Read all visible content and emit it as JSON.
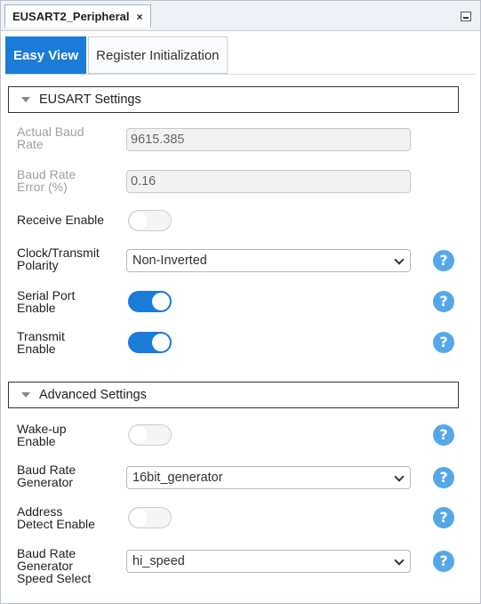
{
  "document_tab": {
    "title": "EUSART2_Peripheral",
    "close_glyph": "×"
  },
  "view_tabs": [
    {
      "label": "Easy View",
      "active": true
    },
    {
      "label": "Register Initialization",
      "active": false
    }
  ],
  "eusart_settings": {
    "header": "EUSART Settings",
    "actual_baud_rate": {
      "label_line1": "Actual Baud",
      "label_line2": "Rate",
      "value": "9615.385"
    },
    "baud_rate_error": {
      "label_line1": "Baud Rate",
      "label_line2": "Error (%)",
      "value": "0.16"
    },
    "receive_enable": {
      "label": "Receive Enable",
      "on": false
    },
    "clock_transmit_polarity": {
      "label_line1": "Clock/Transmit",
      "label_line2": "Polarity",
      "value": "Non-Inverted"
    },
    "serial_port_enable": {
      "label_line1": "Serial Port",
      "label_line2": "Enable",
      "on": true
    },
    "transmit_enable": {
      "label_line1": "Transmit",
      "label_line2": "Enable",
      "on": true
    }
  },
  "advanced_settings": {
    "header": "Advanced Settings",
    "wake_up_enable": {
      "label_line1": "Wake-up",
      "label_line2": "Enable",
      "on": false
    },
    "baud_rate_generator": {
      "label_line1": "Baud Rate",
      "label_line2": "Generator",
      "value": "16bit_generator"
    },
    "address_detect_enable": {
      "label_line1": "Address",
      "label_line2": "Detect Enable",
      "on": false
    },
    "baud_rate_speed_select": {
      "label_line1": "Baud Rate",
      "label_line2": "Generator",
      "label_line3": "Speed Select",
      "value": "hi_speed"
    }
  },
  "help_glyph": "?",
  "colors": {
    "accent": "#1a7bd8",
    "help": "#55a7e8",
    "disabled_text": "#9aa0a6"
  }
}
